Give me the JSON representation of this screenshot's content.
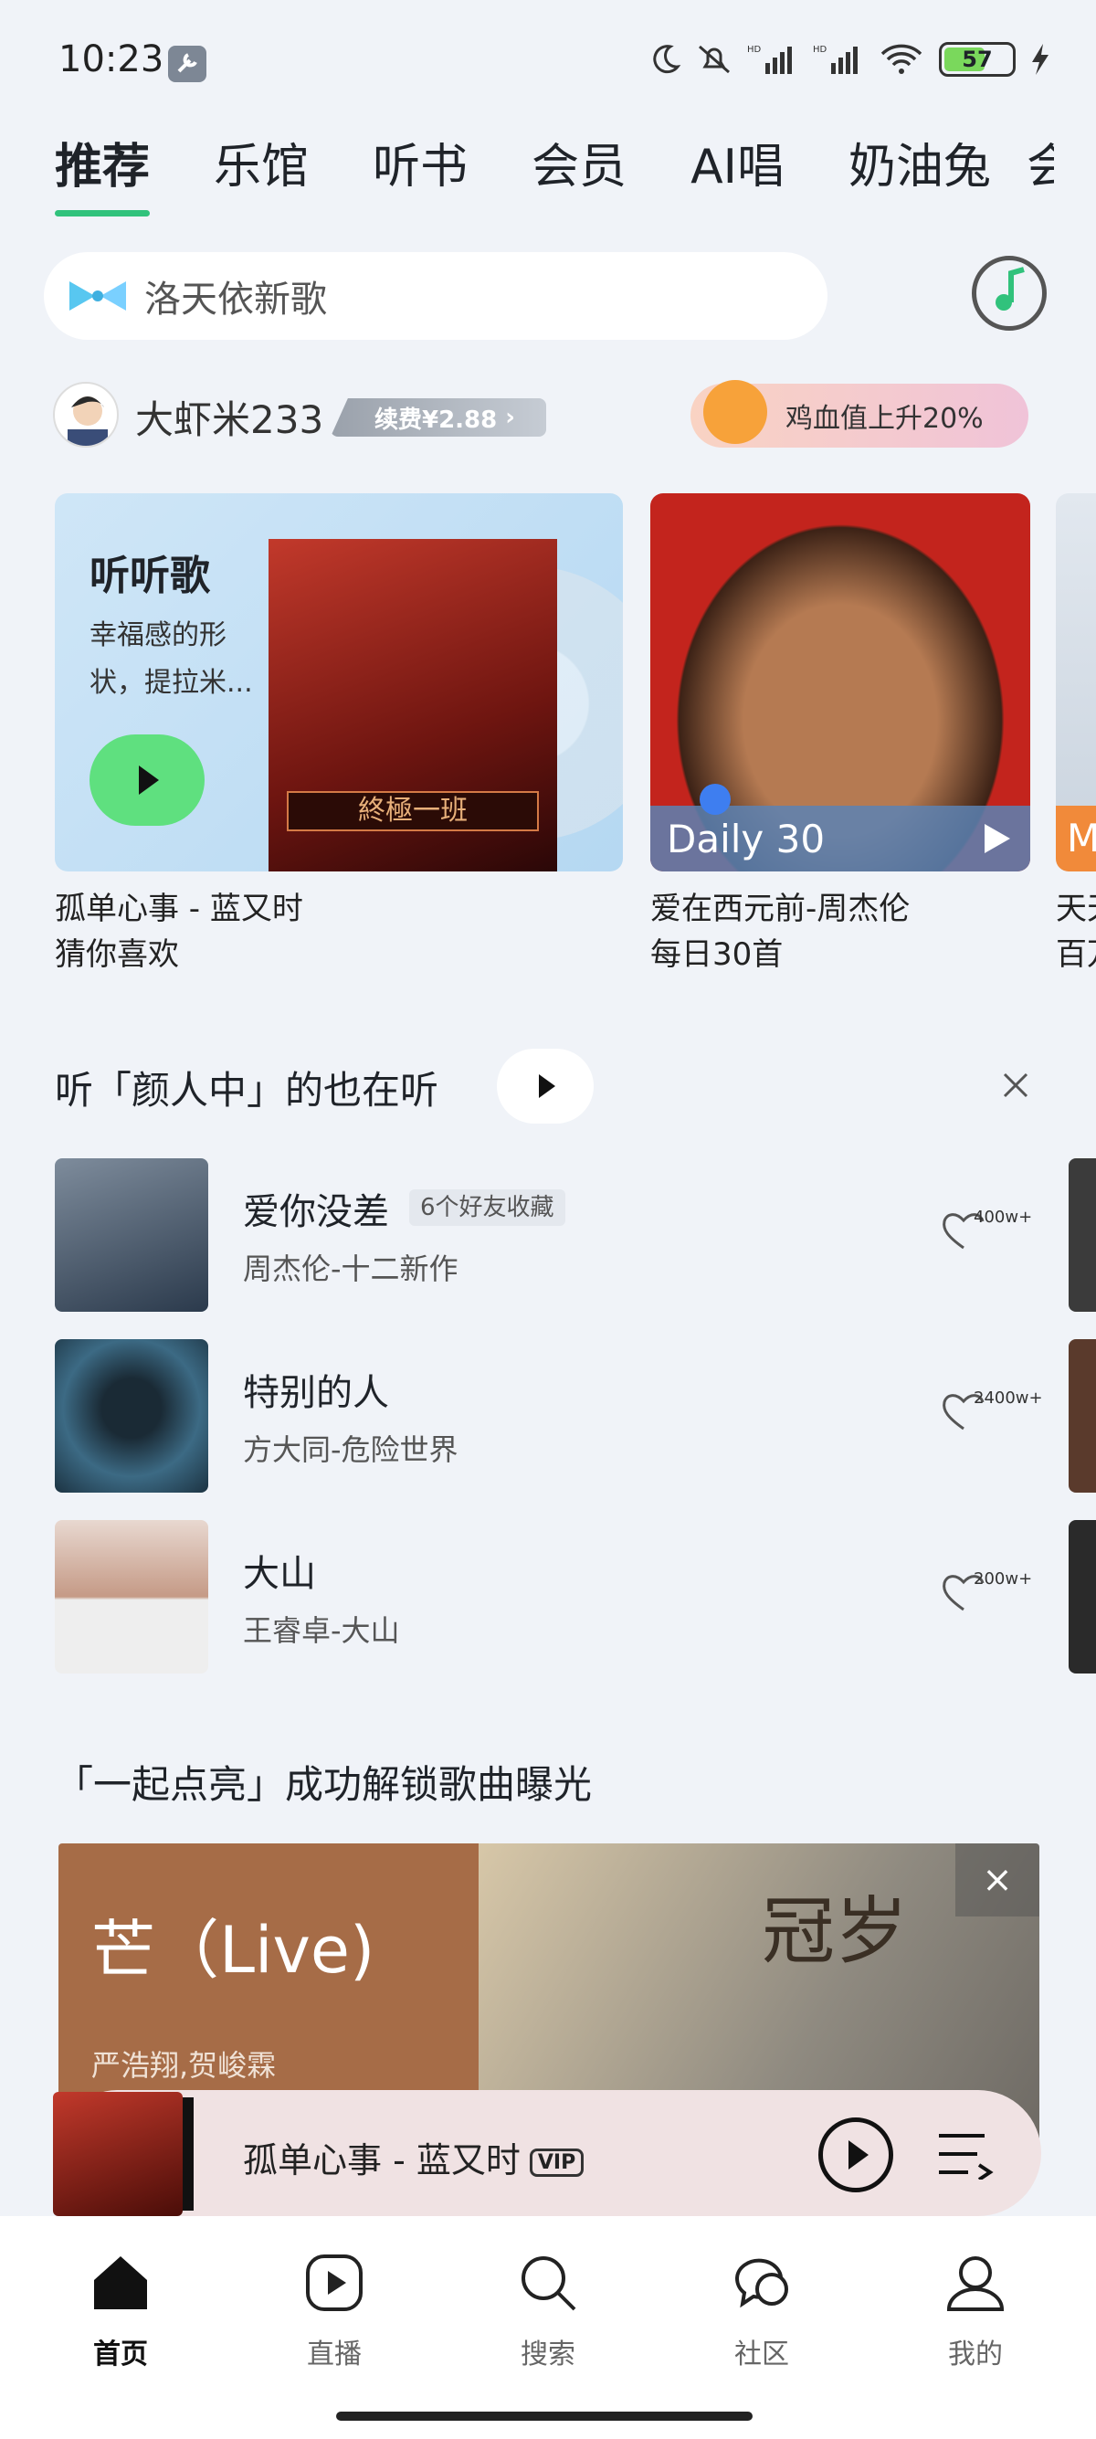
{
  "status_bar": {
    "time": "10:23",
    "battery": "57"
  },
  "tabs": [
    "推荐",
    "乐馆",
    "听书",
    "会员",
    "AI唱",
    "奶油兔",
    "会"
  ],
  "search": {
    "placeholder": "洛天依新歌"
  },
  "user": {
    "name": "大虾米233",
    "renew": "续费¥2.88",
    "promo": "鸡血值上升20%"
  },
  "cards": [
    {
      "title": "听听歌",
      "desc": "幸福感的形状，提拉米...",
      "album_text": "終極一班",
      "caption1": "孤单心事 - 蓝又时",
      "caption2": "猜你喜欢"
    },
    {
      "label": "Daily 30",
      "caption1": "爱在西元前-周杰伦",
      "caption2": "每日30首"
    },
    {
      "label": "M",
      "caption1": "天天",
      "caption2": "百万"
    }
  ],
  "section": {
    "title": "听「颜人中」的也在听"
  },
  "songs": [
    {
      "name": "爱你没差",
      "badge": "6个好友收藏",
      "sub": "周杰伦-十二新作",
      "count": "400w+",
      "cover": "#2b3a4c"
    },
    {
      "name": "特别的人",
      "badge": "",
      "sub": "方大同-危险世界",
      "count": "2400w+",
      "cover": "#24455d"
    },
    {
      "name": "大山",
      "badge": "",
      "sub": "王睿卓-大山",
      "count": "200w+",
      "cover": "#d9c6bd"
    }
  ],
  "banner": {
    "title": "「一起点亮」成功解锁歌曲曝光",
    "song": "芒（Live)",
    "artists": "严浩翔,贺峻霖",
    "right_text": "冠岁"
  },
  "player": {
    "title": "孤单心事 - 蓝又时",
    "vip": "VIP"
  },
  "nav": [
    {
      "label": "首页",
      "icon": "home-icon",
      "active": true
    },
    {
      "label": "直播",
      "icon": "live-icon"
    },
    {
      "label": "搜索",
      "icon": "search-icon"
    },
    {
      "label": "社区",
      "icon": "community-icon"
    },
    {
      "label": "我的",
      "icon": "profile-icon"
    }
  ],
  "colors": {
    "accent": "#31c27c",
    "background": "#f0f3f8"
  }
}
